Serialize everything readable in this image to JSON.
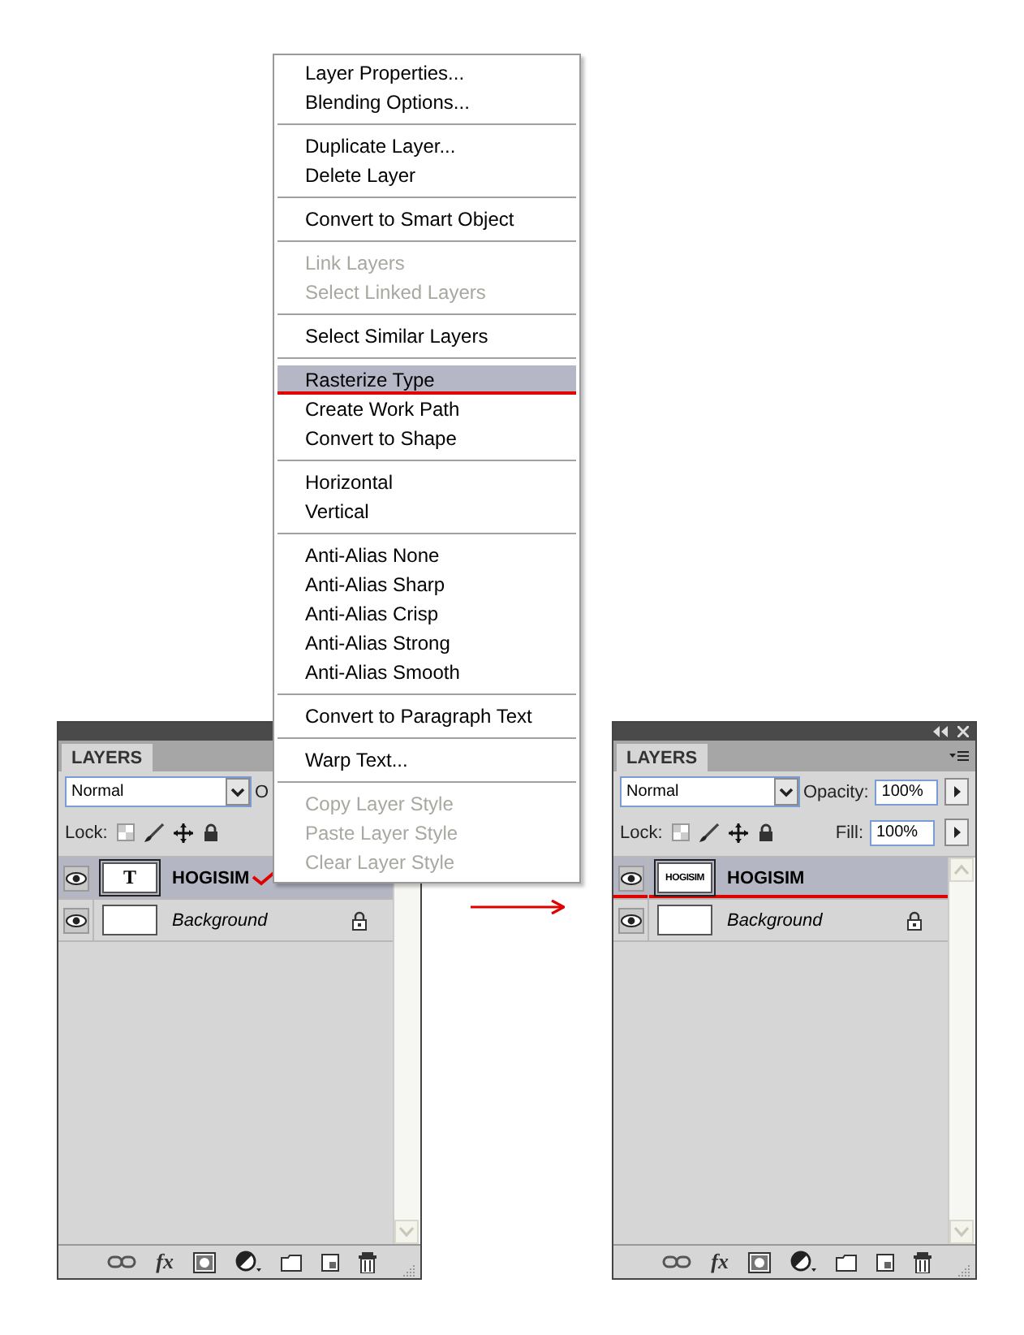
{
  "panels": [
    {
      "tab": "LAYERS",
      "blend_mode": "Normal",
      "opacity_label": "O",
      "lock_label": "Lock:",
      "title_controls": false,
      "scroll_up_arrow": false,
      "layers": [
        {
          "name": "HOGISIM",
          "kind": "text",
          "thumbnail_text": "T",
          "selected": true,
          "checkmark": true,
          "underlined": false
        },
        {
          "name": "Background",
          "kind": "background",
          "selected": false,
          "checkmark": false,
          "underlined": false
        }
      ],
      "footer_fx": "fx"
    },
    {
      "tab": "LAYERS",
      "blend_mode": "Normal",
      "opacity_label": "Opacity:",
      "opacity": "100%",
      "fill_label": "Fill:",
      "fill": "100%",
      "lock_label": "Lock:",
      "title_controls": true,
      "scroll_up_arrow": true,
      "layers": [
        {
          "name": "HOGISIM",
          "kind": "raster",
          "thumbnail_text": "HOGISIM",
          "selected": true,
          "checkmark": false,
          "underlined": true
        },
        {
          "name": "Background",
          "kind": "background",
          "selected": false,
          "checkmark": false,
          "underlined": false
        }
      ],
      "footer_fx": "fx"
    }
  ],
  "context_menu": {
    "groups": [
      [
        {
          "label": "Layer Properties...",
          "disabled": false,
          "selected": false,
          "underlined": false
        },
        {
          "label": "Blending Options...",
          "disabled": false,
          "selected": false,
          "underlined": false
        }
      ],
      [
        {
          "label": "Duplicate Layer...",
          "disabled": false,
          "selected": false,
          "underlined": false
        },
        {
          "label": "Delete Layer",
          "disabled": false,
          "selected": false,
          "underlined": false
        }
      ],
      [
        {
          "label": "Convert to Smart Object",
          "disabled": false,
          "selected": false,
          "underlined": false
        }
      ],
      [
        {
          "label": "Link Layers",
          "disabled": true,
          "selected": false,
          "underlined": false
        },
        {
          "label": "Select Linked Layers",
          "disabled": true,
          "selected": false,
          "underlined": false
        }
      ],
      [
        {
          "label": "Select Similar Layers",
          "disabled": false,
          "selected": false,
          "underlined": false
        }
      ],
      [
        {
          "label": "Rasterize Type",
          "disabled": false,
          "selected": true,
          "underlined": true
        },
        {
          "label": "Create Work Path",
          "disabled": false,
          "selected": false,
          "underlined": false
        },
        {
          "label": "Convert to Shape",
          "disabled": false,
          "selected": false,
          "underlined": false
        }
      ],
      [
        {
          "label": "Horizontal",
          "disabled": false,
          "selected": false,
          "underlined": false
        },
        {
          "label": "Vertical",
          "disabled": false,
          "selected": false,
          "underlined": false
        }
      ],
      [
        {
          "label": "Anti-Alias None",
          "disabled": false,
          "selected": false,
          "underlined": false
        },
        {
          "label": "Anti-Alias Sharp",
          "disabled": false,
          "selected": false,
          "underlined": false
        },
        {
          "label": "Anti-Alias Crisp",
          "disabled": false,
          "selected": false,
          "underlined": false
        },
        {
          "label": "Anti-Alias Strong",
          "disabled": false,
          "selected": false,
          "underlined": false
        },
        {
          "label": "Anti-Alias Smooth",
          "disabled": false,
          "selected": false,
          "underlined": false
        }
      ],
      [
        {
          "label": "Convert to Paragraph Text",
          "disabled": false,
          "selected": false,
          "underlined": false
        }
      ],
      [
        {
          "label": "Warp Text...",
          "disabled": false,
          "selected": false,
          "underlined": false
        }
      ],
      [
        {
          "label": "Copy Layer Style",
          "disabled": true,
          "selected": false,
          "underlined": false
        },
        {
          "label": "Paste Layer Style",
          "disabled": true,
          "selected": false,
          "underlined": false
        },
        {
          "label": "Clear Layer Style",
          "disabled": true,
          "selected": false,
          "underlined": false
        }
      ]
    ]
  },
  "arrow": true
}
